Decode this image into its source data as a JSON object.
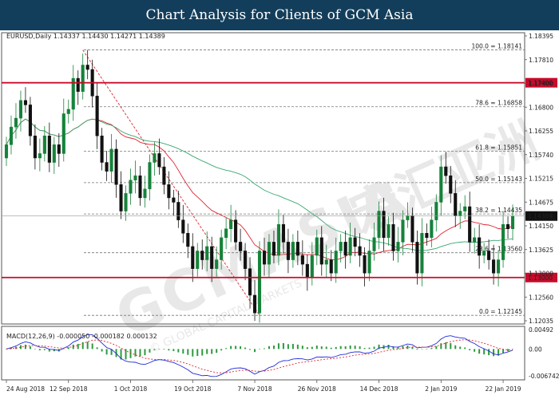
{
  "header": {
    "title": "Chart Analysis for Clients of GCM Asia"
  },
  "watermark": {
    "text": "GCMASIA",
    "chinese": "宏汇亚洲",
    "sub": "© GLOBAL CAPITAL MARKETS"
  },
  "chart_data": {
    "type": "candlestick",
    "symbol_line": "EURUSD,Daily  1.14337 1.14430 1.14271 1.14389",
    "colors": {
      "bull": "#16823a",
      "bear": "#111111",
      "ma_fast": "#e0242f",
      "ma_slow": "#3aa870",
      "hline": "#c80b2b",
      "macd_line": "#1f2bd8",
      "macd_signal": "#e0242f",
      "macd_hist": "#2e9a3e"
    },
    "ylim": [
      1.1195,
      1.1853
    ],
    "price_ticks": [
      "1.18395",
      "1.17810",
      "1.17400",
      "1.16800",
      "1.16255",
      "1.15740",
      "1.15215",
      "1.14675",
      "1.14150",
      "1.13625",
      "1.13000",
      "1.12560",
      "1.12035"
    ],
    "current_price": "1.14389",
    "horizontal_lines": [
      {
        "label": "1.17400",
        "value": 1.174
      },
      {
        "label": "1.13000",
        "value": 1.13
      }
    ],
    "fibonacci": [
      {
        "label": "100.0 = 1.18141",
        "value": 1.18141
      },
      {
        "label": "78.6 = 1.16858",
        "value": 1.16858
      },
      {
        "label": "61.8 = 1.15851",
        "value": 1.15851
      },
      {
        "label": "50.0 = 1.15143",
        "value": 1.15143
      },
      {
        "label": "38.2 = 1.14435",
        "value": 1.14435
      },
      {
        "label": "23.6 = 1.13560",
        "value": 1.1356
      },
      {
        "label": "0.0 = 1.12145",
        "value": 1.12145
      }
    ],
    "x_labels": [
      "24 Aug 2018",
      "12 Sep 2018",
      "1 Oct 2018",
      "19 Oct 2018",
      "7 Nov 2018",
      "26 Nov 2018",
      "14 Dec 2018",
      "2 Jan 2019",
      "22 Jan 2019"
    ],
    "x_label_index": [
      0,
      13,
      26,
      39,
      52,
      65,
      78,
      91,
      104
    ],
    "closes": [
      1.16,
      1.164,
      1.166,
      1.17,
      1.169,
      1.162,
      1.157,
      1.158,
      1.162,
      1.156,
      1.16,
      1.158,
      1.167,
      1.168,
      1.175,
      1.172,
      1.178,
      1.177,
      1.171,
      1.162,
      1.156,
      1.154,
      1.159,
      1.151,
      1.145,
      1.149,
      1.152,
      1.153,
      1.148,
      1.15,
      1.156,
      1.158,
      1.155,
      1.151,
      1.148,
      1.147,
      1.143,
      1.14,
      1.137,
      1.132,
      1.136,
      1.134,
      1.137,
      1.132,
      1.134,
      1.139,
      1.141,
      1.143,
      1.138,
      1.136,
      1.132,
      1.126,
      1.122,
      1.136,
      1.133,
      1.138,
      1.135,
      1.142,
      1.138,
      1.134,
      1.138,
      1.135,
      1.133,
      1.13,
      1.135,
      1.139,
      1.133,
      1.134,
      1.131,
      1.136,
      1.138,
      1.135,
      1.139,
      1.137,
      1.135,
      1.131,
      1.136,
      1.139,
      1.145,
      1.139,
      1.142,
      1.136,
      1.138,
      1.143,
      1.144,
      1.138,
      1.131,
      1.14,
      1.139,
      1.143,
      1.147,
      1.155,
      1.153,
      1.149,
      1.144,
      1.145,
      1.146,
      1.138,
      1.139,
      1.135,
      1.136,
      1.134,
      1.131,
      1.134,
      1.142,
      1.141,
      1.1439
    ],
    "macd": {
      "label": "MACD(12,26,9) -0.000050 -0.000182 0.000132",
      "ticks": [
        "0.00492",
        "0.00",
        "-0.006742"
      ],
      "ylim": [
        -0.0075,
        0.0055
      ]
    }
  }
}
